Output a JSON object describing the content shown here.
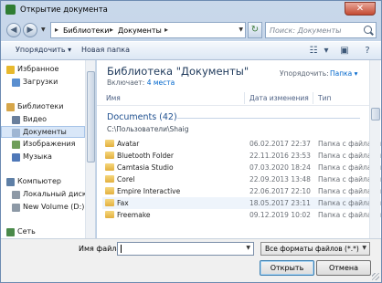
{
  "window": {
    "title": "Открытие документа",
    "close_glyph": "✕"
  },
  "nav": {
    "back_glyph": "◀",
    "forward_glyph": "▶",
    "dropdown_glyph": "▼",
    "breadcrumb": [
      "Библиотеки",
      "Документы"
    ],
    "separator_glyph": "▸",
    "search_placeholder": "Поиск: Документы",
    "refresh_glyph": "↻"
  },
  "toolbar": {
    "organize_label": "Упорядочить ▾",
    "new_folder_label": "Новая папка",
    "view_glyph": "☷",
    "view_drop_glyph": "▾",
    "preview_glyph": "▣",
    "help_glyph": "?"
  },
  "sidebar": {
    "items": [
      {
        "label": "Избранное",
        "icon": "star-icon",
        "color": "#e8b92d"
      },
      {
        "label": "Загрузки",
        "icon": "downloads-icon",
        "color": "#5a8fd0"
      },
      {
        "label": "Библиотеки",
        "icon": "libraries-icon",
        "color": "#d6a64a"
      },
      {
        "label": "Видео",
        "icon": "video-icon",
        "color": "#6a7f9c"
      },
      {
        "label": "Документы",
        "icon": "documents-icon",
        "color": "#9fb6d3"
      },
      {
        "label": "Изображения",
        "icon": "pictures-icon",
        "color": "#6f9e5b"
      },
      {
        "label": "Музыка",
        "icon": "music-icon",
        "color": "#4f78b8"
      },
      {
        "label": "Компьютер",
        "icon": "computer-icon",
        "color": "#5e7fa6"
      },
      {
        "label": "Локальный диск",
        "icon": "drive-icon",
        "color": "#8d99a6"
      },
      {
        "label": "New Volume (D:)",
        "icon": "drive-icon",
        "color": "#8d99a6"
      },
      {
        "label": "Сеть",
        "icon": "network-icon",
        "color": "#4a8a4a"
      }
    ]
  },
  "library": {
    "title": "Библиотека \"Документы\"",
    "includes_label": "Включает:",
    "includes_value": "4 места",
    "arrange_label": "Упорядочить:",
    "arrange_value": "Папка ▾"
  },
  "columns": {
    "name": "Имя",
    "date": "Дата изменения",
    "type": "Тип"
  },
  "group": {
    "title": "Documents (42)",
    "path": "C:\\Пользователи\\Shaig"
  },
  "rows": [
    {
      "name": "Avatar",
      "date": "06.02.2017 22:37",
      "type": "Папка с файлами"
    },
    {
      "name": "Bluetooth Folder",
      "date": "22.11.2016 23:53",
      "type": "Папка с файлами"
    },
    {
      "name": "Camtasia Studio",
      "date": "07.03.2020 18:24",
      "type": "Папка с файлами"
    },
    {
      "name": "Corel",
      "date": "22.09.2013 13:48",
      "type": "Папка с файлами"
    },
    {
      "name": "Empire Interactive",
      "date": "22.06.2017 22:10",
      "type": "Папка с файлами"
    },
    {
      "name": "Fax",
      "date": "18.05.2017 23:11",
      "type": "Папка с файлами"
    },
    {
      "name": "Freemake",
      "date": "09.12.2019 10:02",
      "type": "Папка с файлами"
    }
  ],
  "bottom": {
    "filename_label": "Имя файла:",
    "filename_value": "",
    "filter_value": "Все форматы файлов (*.*)",
    "open_label": "Открыть",
    "cancel_label": "Отмена"
  }
}
